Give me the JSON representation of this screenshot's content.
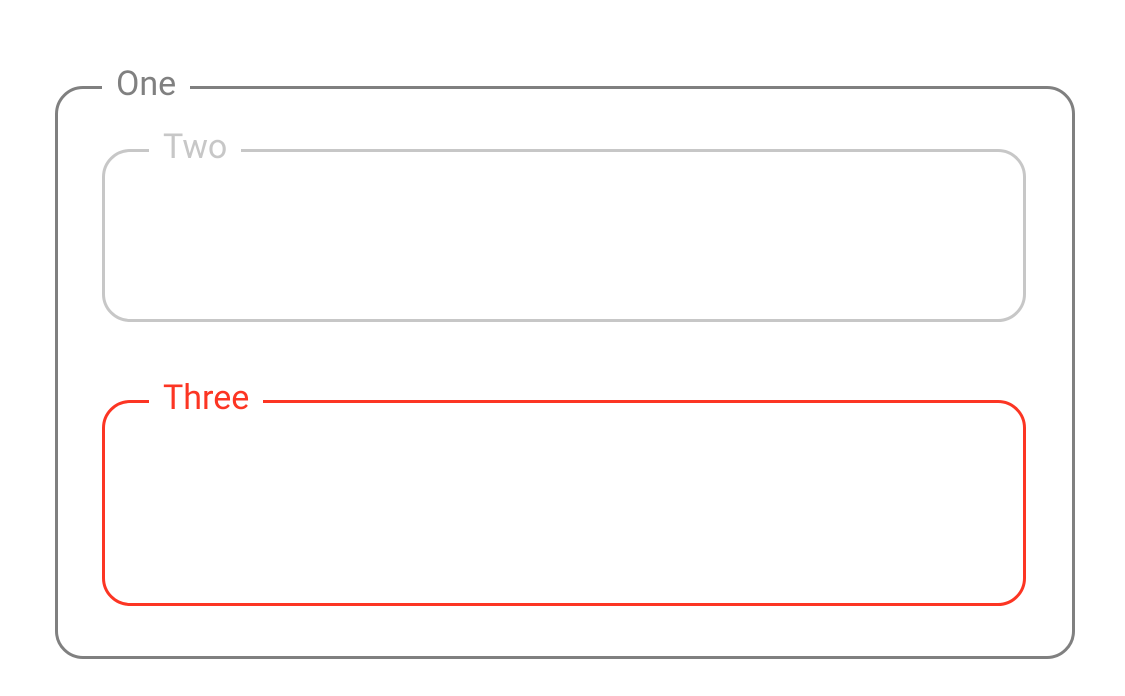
{
  "groupboxes": {
    "one": {
      "label": "One",
      "color": "#808080"
    },
    "two": {
      "label": "Two",
      "color": "#c7c7c7"
    },
    "three": {
      "label": "Three",
      "color": "#fc3523"
    }
  }
}
